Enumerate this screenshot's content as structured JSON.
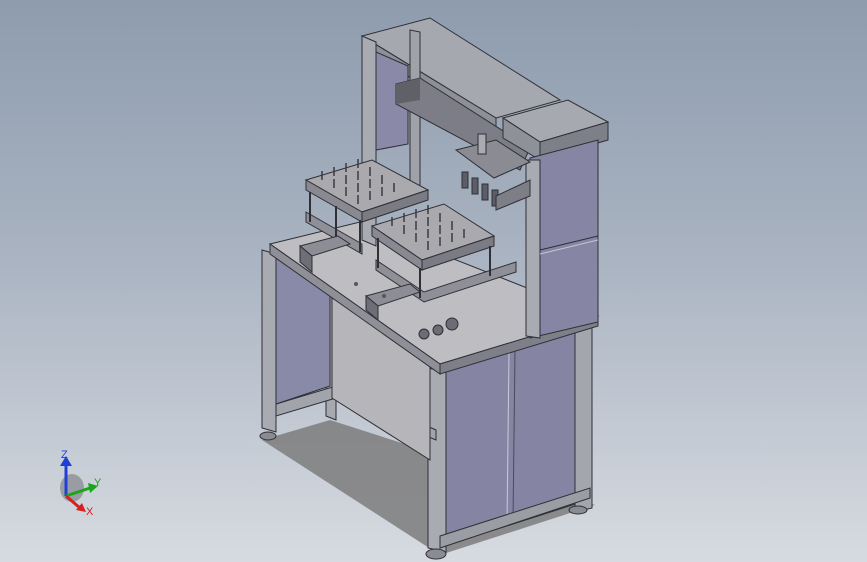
{
  "scene": {
    "model": "dispensing-workstation",
    "background": {
      "top": "#8e9cae",
      "bottom": "#d7dbe1"
    },
    "colors": {
      "frame": "#9a9ca3",
      "frame_edge": "#3b3d44",
      "panel": "#8a8aa6",
      "panel_dark": "#6f6f8c",
      "table_top": "#b8b8bd",
      "shadow": "#7a7a7a",
      "fixture": "#a6a6ab"
    }
  },
  "triad": {
    "z_label": "Z",
    "y_label": "Y",
    "x_label": "X",
    "z_color": "#1f3fd6",
    "y_color": "#1aa61a",
    "x_color": "#d61f1f"
  }
}
